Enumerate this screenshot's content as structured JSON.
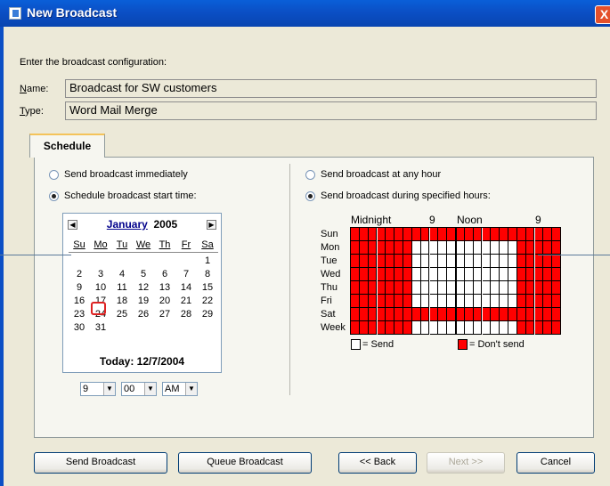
{
  "window": {
    "title": "New Broadcast",
    "close": "X"
  },
  "intro": "Enter the broadcast configuration:",
  "name": {
    "label": "Name:",
    "value": "Broadcast for SW customers"
  },
  "type": {
    "label": "Type:",
    "value": "Word Mail Merge"
  },
  "tabs": [
    {
      "label": "Schedule",
      "active": true
    }
  ],
  "left": {
    "radio_immediate": {
      "label": "Send broadcast immediately",
      "selected": false
    },
    "radio_schedule": {
      "label": "Schedule broadcast start time:",
      "selected": true
    }
  },
  "calendar": {
    "month": "January",
    "year": "2005",
    "prev": "◀",
    "next": "▶",
    "weekdays": [
      "Su",
      "Mo",
      "Tu",
      "We",
      "Th",
      "Fr",
      "Sa"
    ],
    "weeks": [
      [
        "",
        "",
        "",
        "",
        "",
        "",
        "1"
      ],
      [
        "2",
        "3",
        "4",
        "5",
        "6",
        "7",
        "8"
      ],
      [
        "9",
        "10",
        "11",
        "12",
        "13",
        "14",
        "15"
      ],
      [
        "16",
        "17",
        "18",
        "19",
        "20",
        "21",
        "22"
      ],
      [
        "23",
        "24",
        "25",
        "26",
        "27",
        "28",
        "29"
      ],
      [
        "30",
        "31",
        "",
        "",
        "",
        "",
        ""
      ]
    ],
    "selected_day": "17",
    "today_label": "Today: 12/7/2004"
  },
  "time": {
    "hour": "9",
    "minute": "00",
    "ampm": "AM"
  },
  "right": {
    "radio_any": {
      "label": "Send broadcast at any hour",
      "selected": false
    },
    "radio_specified": {
      "label": "Send broadcast during specified hours:",
      "selected": true
    }
  },
  "hours_grid": {
    "column_labels": [
      "Midnight",
      "9",
      "Noon",
      "9"
    ],
    "row_labels": [
      "Sun",
      "Mon",
      "Tue",
      "Wed",
      "Thu",
      "Fri",
      "Sat",
      "Week"
    ],
    "columns": 24,
    "send_rows": [
      "Mon",
      "Tue",
      "Wed",
      "Thu",
      "Fri"
    ],
    "send_hours_start": 7,
    "send_hours_end": 19,
    "week_row_send_hours_start": 7,
    "week_row_send_hours_end": 19,
    "color_send": "#ffffff",
    "color_dont_send": "#ff0000"
  },
  "legend": {
    "send": "= Send",
    "dont_send": "= Don't send"
  },
  "buttons": {
    "send_broadcast": "Send Broadcast",
    "queue_broadcast": "Queue Broadcast",
    "back": "<< Back",
    "next": "Next >>",
    "cancel": "Cancel"
  }
}
